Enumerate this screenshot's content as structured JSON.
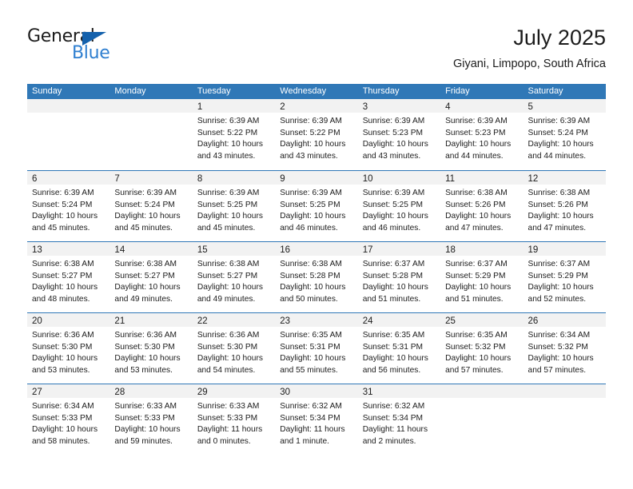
{
  "brand": {
    "name_part1": "General",
    "name_part2": "Blue",
    "triangle_color": "#1461ac",
    "blue_color": "#2f7fd0"
  },
  "header": {
    "title": "July 2025",
    "subtitle": "Giyani, Limpopo, South Africa"
  },
  "theme": {
    "header_blue": "#3078b7",
    "daynum_band": "#f2f2f2",
    "text": "#1c1c1c"
  },
  "weekdays": [
    "Sunday",
    "Monday",
    "Tuesday",
    "Wednesday",
    "Thursday",
    "Friday",
    "Saturday"
  ],
  "weeks": [
    {
      "days": [
        {
          "num": "",
          "lines": [
            "",
            "",
            "",
            ""
          ]
        },
        {
          "num": "",
          "lines": [
            "",
            "",
            "",
            ""
          ]
        },
        {
          "num": "1",
          "lines": [
            "Sunrise: 6:39 AM",
            "Sunset: 5:22 PM",
            "Daylight: 10 hours",
            "and 43 minutes."
          ]
        },
        {
          "num": "2",
          "lines": [
            "Sunrise: 6:39 AM",
            "Sunset: 5:22 PM",
            "Daylight: 10 hours",
            "and 43 minutes."
          ]
        },
        {
          "num": "3",
          "lines": [
            "Sunrise: 6:39 AM",
            "Sunset: 5:23 PM",
            "Daylight: 10 hours",
            "and 43 minutes."
          ]
        },
        {
          "num": "4",
          "lines": [
            "Sunrise: 6:39 AM",
            "Sunset: 5:23 PM",
            "Daylight: 10 hours",
            "and 44 minutes."
          ]
        },
        {
          "num": "5",
          "lines": [
            "Sunrise: 6:39 AM",
            "Sunset: 5:24 PM",
            "Daylight: 10 hours",
            "and 44 minutes."
          ]
        }
      ]
    },
    {
      "days": [
        {
          "num": "6",
          "lines": [
            "Sunrise: 6:39 AM",
            "Sunset: 5:24 PM",
            "Daylight: 10 hours",
            "and 45 minutes."
          ]
        },
        {
          "num": "7",
          "lines": [
            "Sunrise: 6:39 AM",
            "Sunset: 5:24 PM",
            "Daylight: 10 hours",
            "and 45 minutes."
          ]
        },
        {
          "num": "8",
          "lines": [
            "Sunrise: 6:39 AM",
            "Sunset: 5:25 PM",
            "Daylight: 10 hours",
            "and 45 minutes."
          ]
        },
        {
          "num": "9",
          "lines": [
            "Sunrise: 6:39 AM",
            "Sunset: 5:25 PM",
            "Daylight: 10 hours",
            "and 46 minutes."
          ]
        },
        {
          "num": "10",
          "lines": [
            "Sunrise: 6:39 AM",
            "Sunset: 5:25 PM",
            "Daylight: 10 hours",
            "and 46 minutes."
          ]
        },
        {
          "num": "11",
          "lines": [
            "Sunrise: 6:38 AM",
            "Sunset: 5:26 PM",
            "Daylight: 10 hours",
            "and 47 minutes."
          ]
        },
        {
          "num": "12",
          "lines": [
            "Sunrise: 6:38 AM",
            "Sunset: 5:26 PM",
            "Daylight: 10 hours",
            "and 47 minutes."
          ]
        }
      ]
    },
    {
      "days": [
        {
          "num": "13",
          "lines": [
            "Sunrise: 6:38 AM",
            "Sunset: 5:27 PM",
            "Daylight: 10 hours",
            "and 48 minutes."
          ]
        },
        {
          "num": "14",
          "lines": [
            "Sunrise: 6:38 AM",
            "Sunset: 5:27 PM",
            "Daylight: 10 hours",
            "and 49 minutes."
          ]
        },
        {
          "num": "15",
          "lines": [
            "Sunrise: 6:38 AM",
            "Sunset: 5:27 PM",
            "Daylight: 10 hours",
            "and 49 minutes."
          ]
        },
        {
          "num": "16",
          "lines": [
            "Sunrise: 6:38 AM",
            "Sunset: 5:28 PM",
            "Daylight: 10 hours",
            "and 50 minutes."
          ]
        },
        {
          "num": "17",
          "lines": [
            "Sunrise: 6:37 AM",
            "Sunset: 5:28 PM",
            "Daylight: 10 hours",
            "and 51 minutes."
          ]
        },
        {
          "num": "18",
          "lines": [
            "Sunrise: 6:37 AM",
            "Sunset: 5:29 PM",
            "Daylight: 10 hours",
            "and 51 minutes."
          ]
        },
        {
          "num": "19",
          "lines": [
            "Sunrise: 6:37 AM",
            "Sunset: 5:29 PM",
            "Daylight: 10 hours",
            "and 52 minutes."
          ]
        }
      ]
    },
    {
      "days": [
        {
          "num": "20",
          "lines": [
            "Sunrise: 6:36 AM",
            "Sunset: 5:30 PM",
            "Daylight: 10 hours",
            "and 53 minutes."
          ]
        },
        {
          "num": "21",
          "lines": [
            "Sunrise: 6:36 AM",
            "Sunset: 5:30 PM",
            "Daylight: 10 hours",
            "and 53 minutes."
          ]
        },
        {
          "num": "22",
          "lines": [
            "Sunrise: 6:36 AM",
            "Sunset: 5:30 PM",
            "Daylight: 10 hours",
            "and 54 minutes."
          ]
        },
        {
          "num": "23",
          "lines": [
            "Sunrise: 6:35 AM",
            "Sunset: 5:31 PM",
            "Daylight: 10 hours",
            "and 55 minutes."
          ]
        },
        {
          "num": "24",
          "lines": [
            "Sunrise: 6:35 AM",
            "Sunset: 5:31 PM",
            "Daylight: 10 hours",
            "and 56 minutes."
          ]
        },
        {
          "num": "25",
          "lines": [
            "Sunrise: 6:35 AM",
            "Sunset: 5:32 PM",
            "Daylight: 10 hours",
            "and 57 minutes."
          ]
        },
        {
          "num": "26",
          "lines": [
            "Sunrise: 6:34 AM",
            "Sunset: 5:32 PM",
            "Daylight: 10 hours",
            "and 57 minutes."
          ]
        }
      ]
    },
    {
      "days": [
        {
          "num": "27",
          "lines": [
            "Sunrise: 6:34 AM",
            "Sunset: 5:33 PM",
            "Daylight: 10 hours",
            "and 58 minutes."
          ]
        },
        {
          "num": "28",
          "lines": [
            "Sunrise: 6:33 AM",
            "Sunset: 5:33 PM",
            "Daylight: 10 hours",
            "and 59 minutes."
          ]
        },
        {
          "num": "29",
          "lines": [
            "Sunrise: 6:33 AM",
            "Sunset: 5:33 PM",
            "Daylight: 11 hours",
            "and 0 minutes."
          ]
        },
        {
          "num": "30",
          "lines": [
            "Sunrise: 6:32 AM",
            "Sunset: 5:34 PM",
            "Daylight: 11 hours",
            "and 1 minute."
          ]
        },
        {
          "num": "31",
          "lines": [
            "Sunrise: 6:32 AM",
            "Sunset: 5:34 PM",
            "Daylight: 11 hours",
            "and 2 minutes."
          ]
        },
        {
          "num": "",
          "lines": [
            "",
            "",
            "",
            ""
          ]
        },
        {
          "num": "",
          "lines": [
            "",
            "",
            "",
            ""
          ]
        }
      ]
    }
  ]
}
